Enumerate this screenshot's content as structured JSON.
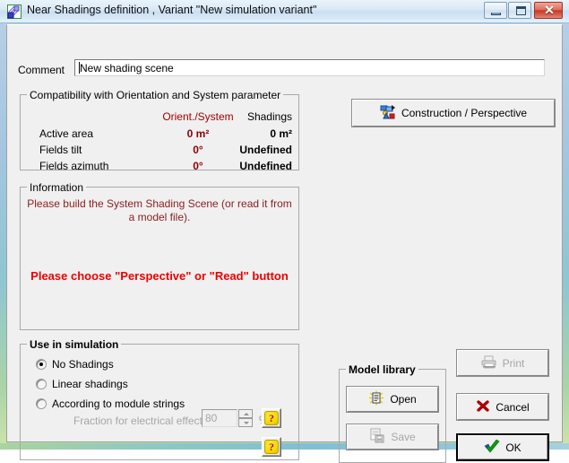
{
  "window": {
    "title": "Near Shadings definition , Variant \"New simulation variant\"",
    "app_icon": "shading-scene-icon",
    "controls": {
      "minimize": "minimize-button",
      "maximize": "maximize-button",
      "close_glyph": "✕"
    }
  },
  "comment": {
    "label": "Comment",
    "value": "New shading scene",
    "placeholder": ""
  },
  "compatibility": {
    "title": "Compatibility with Orientation and System parameter",
    "columns": [
      "Orient./System",
      "Shadings"
    ],
    "rows": [
      {
        "label": "Active area",
        "orient": "0 m²",
        "shadings": "0 m²"
      },
      {
        "label": "Fields tilt",
        "orient": "0°",
        "shadings": "Undefined"
      },
      {
        "label": "Fields azimuth",
        "orient": "0°",
        "shadings": "Undefined"
      }
    ],
    "orient_color": "#8b0000",
    "shadings_color": "#000000"
  },
  "information": {
    "title": "Information",
    "line1": "Please build the System Shading Scene  (or read it from a model file).",
    "line2": "Please choose \"Perspective\" or \"Read\" button",
    "line1_color": "#8b2020",
    "line2_color": "#ee0000"
  },
  "use_in_simulation": {
    "title": "Use in simulation",
    "options": [
      {
        "label": "No Shadings",
        "selected": true
      },
      {
        "label": "Linear shadings",
        "selected": false
      },
      {
        "label": "According to module strings",
        "selected": false
      }
    ],
    "fraction": {
      "label": "Fraction for electrical effect",
      "value": "80",
      "unit": "%",
      "enabled": false
    },
    "help_label": "?"
  },
  "model_library": {
    "title": "Model library",
    "open_label": "Open",
    "save_label": "Save",
    "save_enabled": false
  },
  "actions": {
    "construction": "Construction / Perspective",
    "print": "Print",
    "print_enabled": false,
    "cancel": "Cancel",
    "ok": "OK"
  }
}
